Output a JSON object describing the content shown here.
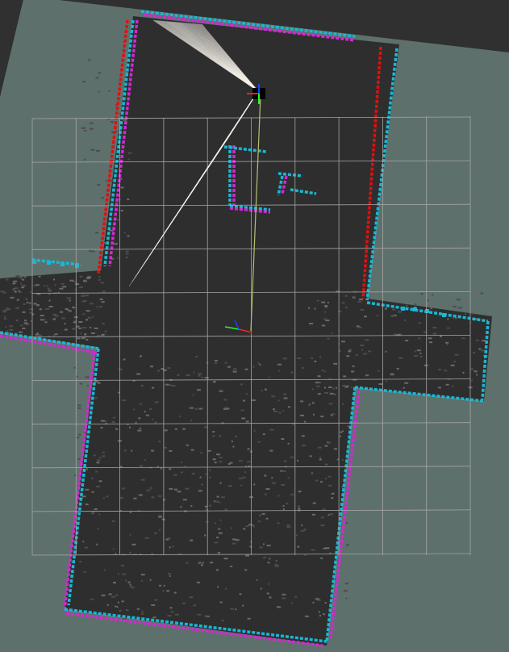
{
  "viewport": {
    "background": "#303030",
    "map_unknown_color": "#5e706c",
    "map_free_color": "#2e2e2e",
    "occupied_colors": [
      "#18b8d4",
      "#d428d4",
      "#e01010"
    ],
    "grid_color": "#a6a6a6",
    "laser_color": "#f4f0e8",
    "robot_axis_colors": {
      "x": "#ff2020",
      "y": "#20ff20",
      "z": "#2040ff"
    },
    "path_color": "#b8c070",
    "grid_cells": {
      "cols": 10,
      "rows": 10
    }
  }
}
